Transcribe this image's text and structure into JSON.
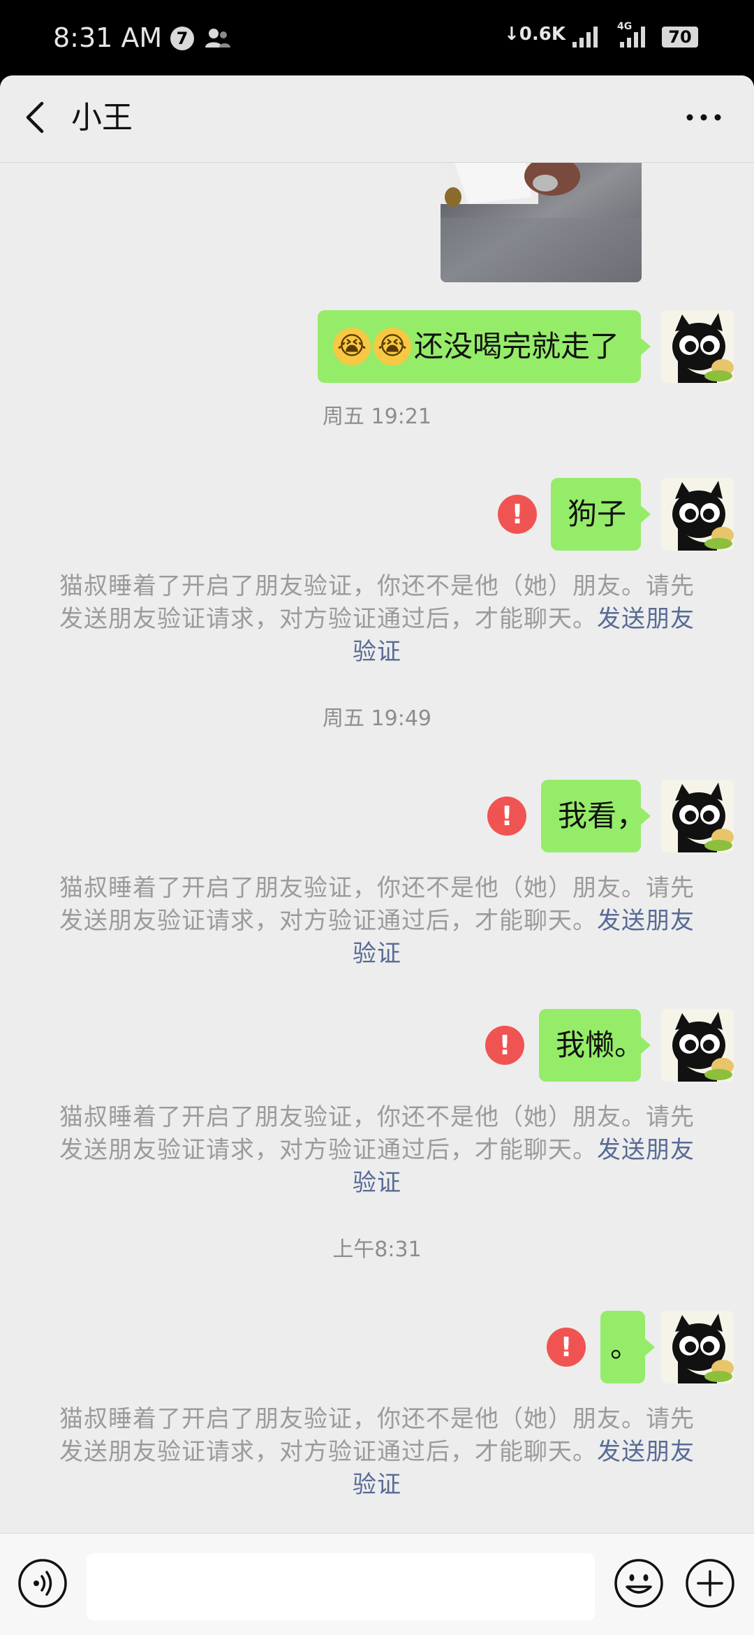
{
  "status_bar": {
    "time": "8:31 AM",
    "notification_count": "7",
    "net_speed": "↓0.6K",
    "network": "4G",
    "battery": "70"
  },
  "header": {
    "title": "小王",
    "more_label": "···"
  },
  "messages": [
    {
      "type": "image",
      "from": "me"
    },
    {
      "type": "text",
      "from": "me",
      "emoji": [
        "😭",
        "😭"
      ],
      "text": "还没喝完就走了"
    },
    {
      "type": "time",
      "text": "周五 19:21"
    },
    {
      "type": "text",
      "from": "me",
      "failed": true,
      "text": "狗子"
    },
    {
      "type": "system",
      "text": "猫叔睡着了开启了朋友验证，你还不是他（她）朋友。请先发送朋友验证请求，对方验证通过后，才能聊天。",
      "link": "发送朋友验证"
    },
    {
      "type": "time",
      "text": "周五 19:49"
    },
    {
      "type": "text",
      "from": "me",
      "failed": true,
      "text": "我看，"
    },
    {
      "type": "system",
      "text": "猫叔睡着了开启了朋友验证，你还不是他（她）朋友。请先发送朋友验证请求，对方验证通过后，才能聊天。",
      "link": "发送朋友验证"
    },
    {
      "type": "text",
      "from": "me",
      "failed": true,
      "text": "我懒。"
    },
    {
      "type": "system",
      "text": "猫叔睡着了开启了朋友验证，你还不是他（她）朋友。请先发送朋友验证请求，对方验证通过后，才能聊天。",
      "link": "发送朋友验证"
    },
    {
      "type": "time",
      "text": "上午8:31"
    },
    {
      "type": "text",
      "from": "me",
      "failed": true,
      "text": "。"
    },
    {
      "type": "system",
      "text": "猫叔睡着了开启了朋友验证，你还不是他（她）朋友。请先发送朋友验证请求，对方验证通过后，才能聊天。",
      "link": "发送朋友验证"
    }
  ],
  "error_icon": "!",
  "input": {
    "value": "",
    "placeholder": ""
  },
  "icons": {
    "back": "chevron-left-icon",
    "more": "more-dots-icon",
    "voice": "voice-icon",
    "sticker": "smiley-icon",
    "plus": "plus-icon",
    "error": "error-icon"
  },
  "colors": {
    "outgoing_bubble": "#95ec69",
    "error": "#f05452",
    "link": "#576b95",
    "background": "#ededed"
  }
}
